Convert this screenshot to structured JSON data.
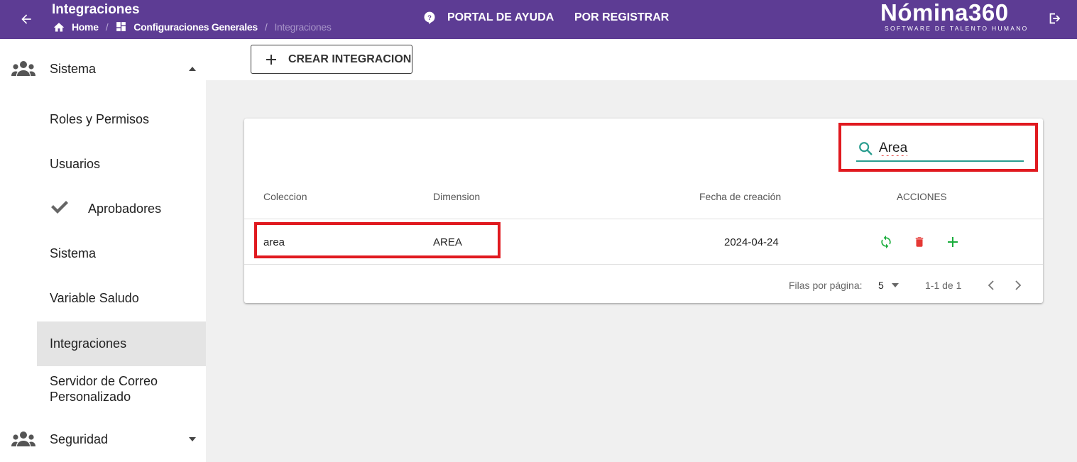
{
  "header": {
    "title": "Integraciones",
    "breadcrumb": [
      "Home",
      "Configuraciones Generales",
      "Integraciones"
    ],
    "help_label": "PORTAL DE AYUDA",
    "register_label": "POR REGISTRAR",
    "logo_text": "Nómina360",
    "logo_subtitle": "SOFTWARE DE TALENTO HUMANO",
    "bg_color": "#5d3c94"
  },
  "sidebar": {
    "groups": [
      {
        "label": "Sistema",
        "icon": "people-icon",
        "expanded": true
      },
      {
        "label": "Seguridad",
        "icon": "people-icon",
        "expanded": false
      }
    ],
    "items": [
      {
        "label": "Roles y Permisos"
      },
      {
        "label": "Usuarios"
      },
      {
        "label": "Aprobadores",
        "icon": "check-icon"
      },
      {
        "label": "Sistema"
      },
      {
        "label": "Variable Saludo"
      },
      {
        "label": "Integraciones",
        "active": true
      },
      {
        "label": "Servidor de Correo Personalizado"
      }
    ]
  },
  "toolbar": {
    "create_label": "CREAR INTEGRACION"
  },
  "search": {
    "value": "Area"
  },
  "table": {
    "columns": [
      "Coleccion",
      "Dimension",
      "Fecha de creación",
      "ACCIONES"
    ],
    "rows": [
      {
        "coleccion": "area",
        "dimension": "AREA",
        "fecha": "2024-04-24"
      }
    ],
    "action_icons": [
      "sync-icon",
      "delete-icon",
      "add-icon"
    ]
  },
  "pagination": {
    "rows_label": "Filas por página:",
    "rows_per_page": "5",
    "range": "1-1 de 1"
  },
  "colors": {
    "accent_teal": "#2a9d8f",
    "sync_green": "#1aad3c",
    "delete_red": "#e53935",
    "highlight_red": "#e0191f"
  }
}
